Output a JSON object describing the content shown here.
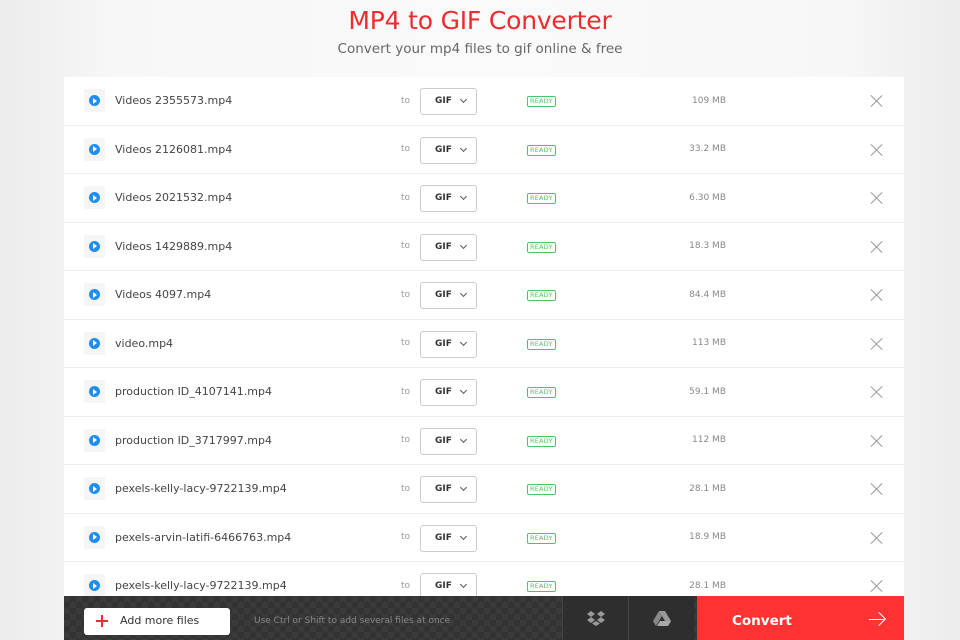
{
  "header": {
    "title": "MP4 to GIF Converter",
    "subtitle": "Convert your mp4 files to gif online & free"
  },
  "files": [
    {
      "name": "Videos 2355573.mp4",
      "to_label": "to",
      "format": "GIF",
      "status": "READY",
      "size": "109 MB"
    },
    {
      "name": "Videos 2126081.mp4",
      "to_label": "to",
      "format": "GIF",
      "status": "READY",
      "size": "33.2 MB"
    },
    {
      "name": "Videos 2021532.mp4",
      "to_label": "to",
      "format": "GIF",
      "status": "READY",
      "size": "6.30 MB"
    },
    {
      "name": "Videos 1429889.mp4",
      "to_label": "to",
      "format": "GIF",
      "status": "READY",
      "size": "18.3 MB"
    },
    {
      "name": "Videos 4097.mp4",
      "to_label": "to",
      "format": "GIF",
      "status": "READY",
      "size": "84.4 MB"
    },
    {
      "name": "video.mp4",
      "to_label": "to",
      "format": "GIF",
      "status": "READY",
      "size": "113 MB"
    },
    {
      "name": "production ID_4107141.mp4",
      "to_label": "to",
      "format": "GIF",
      "status": "READY",
      "size": "59.1 MB"
    },
    {
      "name": "production ID_3717997.mp4",
      "to_label": "to",
      "format": "GIF",
      "status": "READY",
      "size": "112 MB"
    },
    {
      "name": "pexels-kelly-lacy-9722139.mp4",
      "to_label": "to",
      "format": "GIF",
      "status": "READY",
      "size": "28.1 MB"
    },
    {
      "name": "pexels-arvin-latifi-6466763.mp4",
      "to_label": "to",
      "format": "GIF",
      "status": "READY",
      "size": "18.9 MB"
    },
    {
      "name": "pexels-kelly-lacy-9722139.mp4",
      "to_label": "to",
      "format": "GIF",
      "status": "READY",
      "size": "28.1 MB"
    }
  ],
  "footer": {
    "add_files_label": "Add more files",
    "hint": "Use Ctrl or Shift to add several files at once",
    "dropbox_icon": "dropbox-icon",
    "gdrive_icon": "google-drive-icon",
    "convert_label": "Convert"
  },
  "colors": {
    "brand_red": "#ee2b2f",
    "convert_bg": "#ff3333",
    "ready_green": "#4cc46c",
    "play_blue": "#1e8ef0"
  }
}
